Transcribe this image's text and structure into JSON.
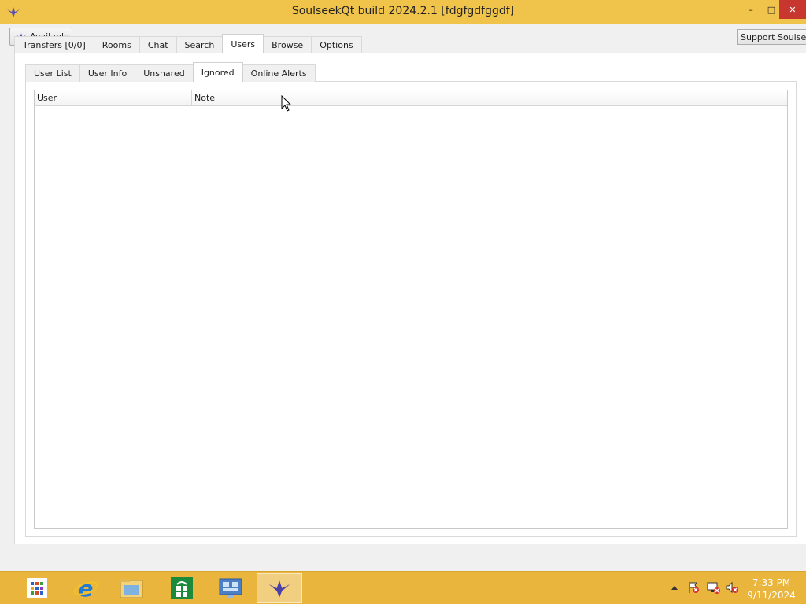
{
  "window": {
    "title": "SoulseekQt build 2024.2.1 [fdgfgdfggdf]",
    "minimize_glyph": "–",
    "maximize_glyph": "□",
    "close_glyph": "✕"
  },
  "toolbar": {
    "status_label": "Available",
    "support_label": "Support Soulseek"
  },
  "main_tabs": [
    {
      "label": "Transfers [0/0]",
      "active": false
    },
    {
      "label": "Rooms",
      "active": false
    },
    {
      "label": "Chat",
      "active": false
    },
    {
      "label": "Search",
      "active": false
    },
    {
      "label": "Users",
      "active": true
    },
    {
      "label": "Browse",
      "active": false
    },
    {
      "label": "Options",
      "active": false
    }
  ],
  "sub_tabs": [
    {
      "label": "User List",
      "active": false
    },
    {
      "label": "User Info",
      "active": false
    },
    {
      "label": "Unshared",
      "active": false
    },
    {
      "label": "Ignored",
      "active": true
    },
    {
      "label": "Online Alerts",
      "active": false
    }
  ],
  "ignored_table": {
    "columns": [
      "User",
      "Note"
    ],
    "rows": []
  },
  "taskbar": {
    "apps": [
      "start-icon",
      "internet-explorer-icon",
      "file-explorer-icon",
      "store-icon",
      "control-panel-icon",
      "soulseek-icon"
    ],
    "active_app": "soulseek-icon",
    "clock_time": "7:33 PM",
    "clock_date": "9/11/2024"
  },
  "colors": {
    "accent": "#f0c34a",
    "taskbar": "#e9b53d",
    "close": "#c7372f"
  }
}
